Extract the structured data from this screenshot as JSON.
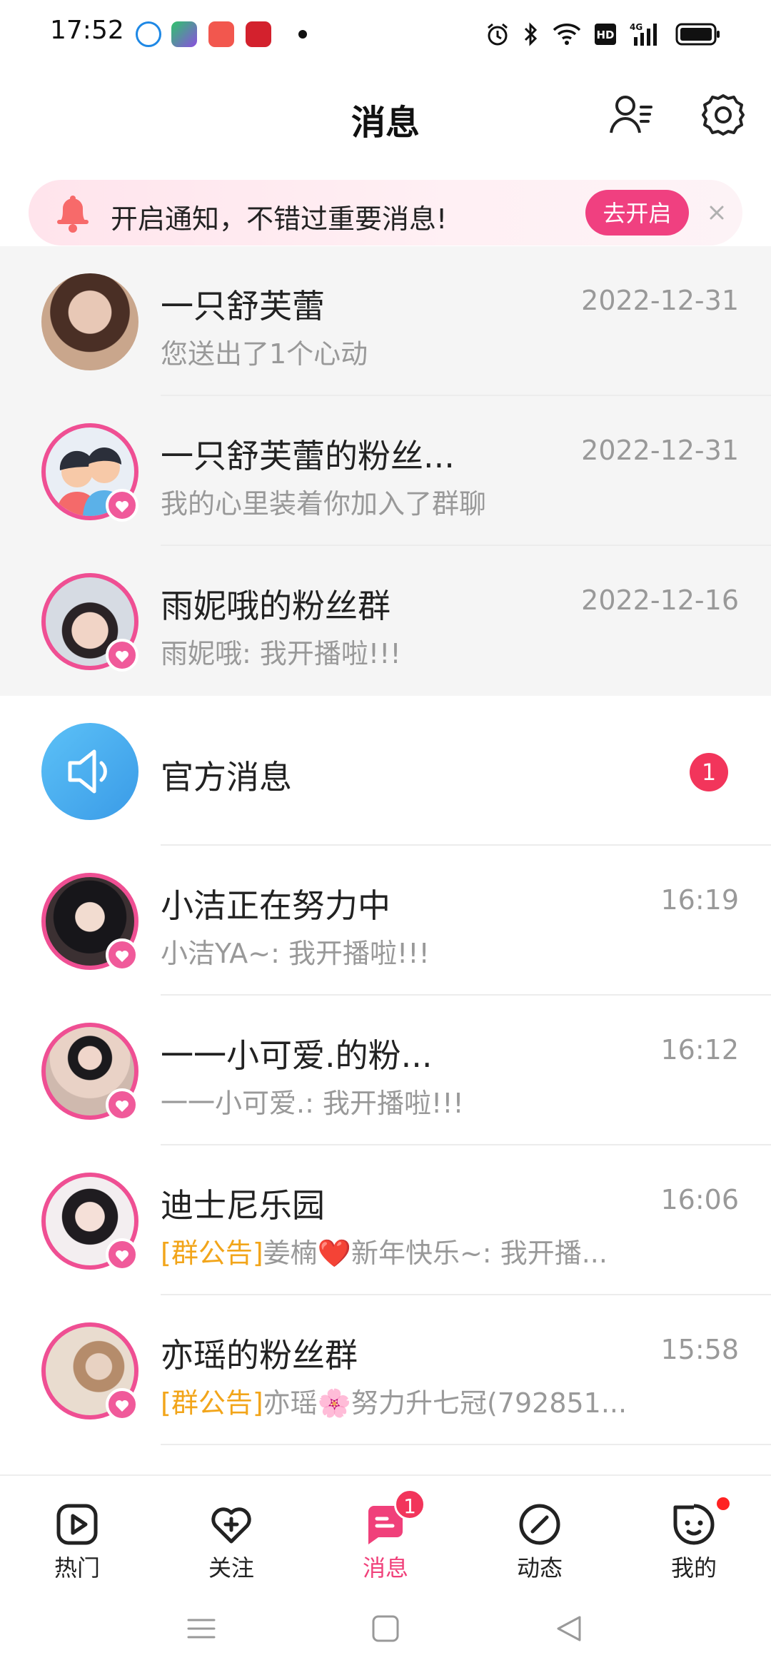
{
  "status_bar": {
    "time": "17:52"
  },
  "header": {
    "title": "消息"
  },
  "notice": {
    "text": "开启通知，不错过重要消息!",
    "button": "去开启"
  },
  "messages": [
    {
      "name": "一只舒芙蕾",
      "preview": "您送出了1个心动",
      "time": "2022-12-31",
      "pinned": true
    },
    {
      "name": "一只舒芙蕾的粉丝...",
      "preview": "我的心里装着你加入了群聊",
      "time": "2022-12-31",
      "pinned": true
    },
    {
      "name": "雨妮哦的粉丝群",
      "preview": "雨妮哦: 我开播啦!!!",
      "time": "2022-12-16",
      "pinned": true
    },
    {
      "name": "官方消息",
      "unread": "1"
    },
    {
      "name": "小洁正在努力中",
      "preview": "小洁YA~: 我开播啦!!!",
      "time": "16:19"
    },
    {
      "name": "一一小可爱.的粉...",
      "preview": "一一小可爱.: 我开播啦!!!",
      "time": "16:12"
    },
    {
      "name": "迪士尼乐园",
      "tag": "[群公告]",
      "preview": "姜楠❤️新年快乐~: 我开播...",
      "time": "16:06"
    },
    {
      "name": "亦瑶的粉丝群",
      "tag": "[群公告]",
      "preview": "亦瑶🌸努力升七冠(792851...",
      "time": "15:58"
    }
  ],
  "tabs": [
    {
      "label": "热门",
      "icon": "play-icon"
    },
    {
      "label": "关注",
      "icon": "heart-plus-icon"
    },
    {
      "label": "消息",
      "icon": "message-icon",
      "badge": "1",
      "active": true
    },
    {
      "label": "动态",
      "icon": "compass-icon"
    },
    {
      "label": "我的",
      "icon": "profile-icon"
    }
  ],
  "colors": {
    "accent": "#f0407a",
    "badge": "#f2355b",
    "notice_bg": "#ffe4ec",
    "tag": "#f2a51a"
  }
}
